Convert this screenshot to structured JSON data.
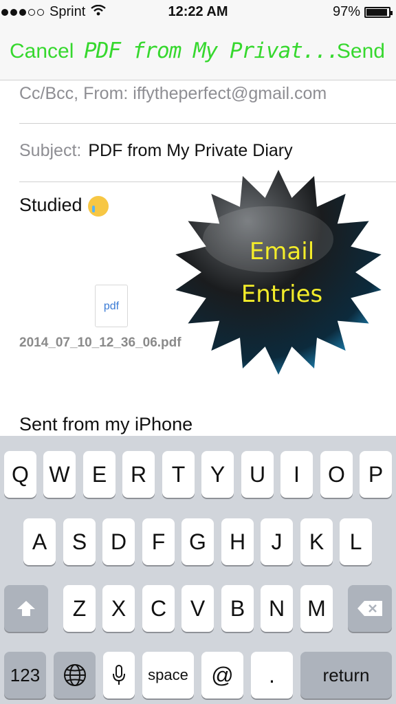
{
  "status_bar": {
    "carrier": "Sprint",
    "time": "12:22 AM",
    "battery": "97%",
    "signal_bars": 3,
    "signal_total": 5,
    "battery_level": 0.97
  },
  "nav": {
    "cancel": "Cancel",
    "title": "PDF from My Privat...",
    "send": "Send",
    "accent_color": "#36d82e"
  },
  "email": {
    "from_line": "Cc/Bcc, From:  iffytheperfect@gmail.com",
    "subject_label": "Subject:",
    "subject_value": "PDF from My Private Diary",
    "body": "Studied",
    "attachment_icon_label": "pdf",
    "attachment_name": "2014_07_10_12_36_06.pdf",
    "signature": "Sent from my iPhone"
  },
  "badge": {
    "line1": "Email",
    "line2": "Entries",
    "text_color": "#f3ec2a"
  },
  "keyboard": {
    "row1": [
      "Q",
      "W",
      "E",
      "R",
      "T",
      "Y",
      "U",
      "I",
      "O",
      "P"
    ],
    "row2": [
      "A",
      "S",
      "D",
      "F",
      "G",
      "H",
      "J",
      "K",
      "L"
    ],
    "row3": [
      "Z",
      "X",
      "C",
      "V",
      "B",
      "N",
      "M"
    ],
    "numbers": "123",
    "space": "space",
    "at": "@",
    "period": ".",
    "return": "return",
    "shift_icon": "shift-arrow-icon",
    "backspace_icon": "backspace-icon",
    "globe_icon": "globe-icon",
    "mic_icon": "microphone-icon"
  }
}
